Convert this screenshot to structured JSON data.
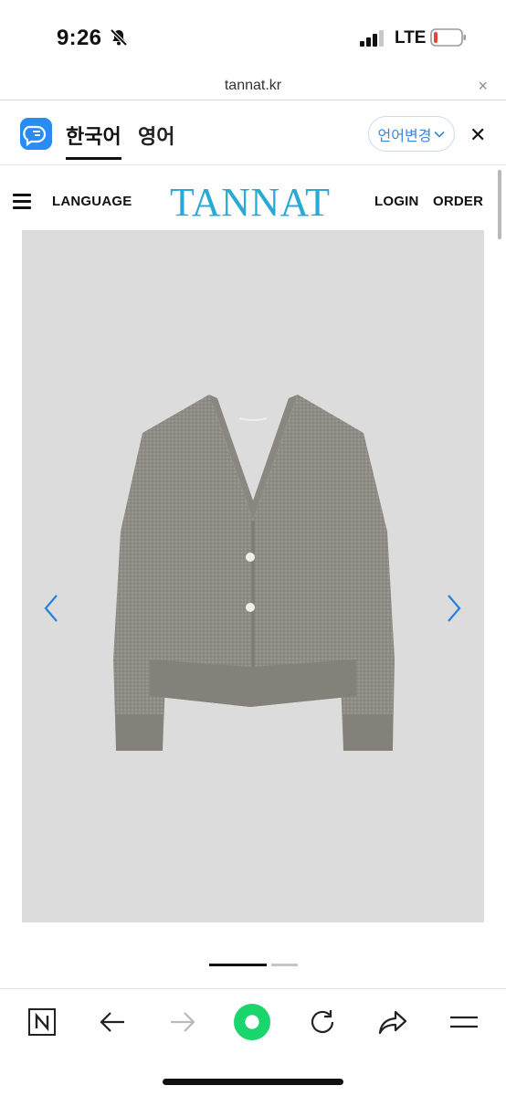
{
  "status_bar": {
    "time": "9:26",
    "network": "LTE",
    "battery_color": "#e0463e"
  },
  "url_bar": {
    "url": "tannat.kr",
    "close_label": "×"
  },
  "translate_bar": {
    "tabs": [
      "한국어",
      "영어"
    ],
    "active_tab": "한국어",
    "change_language_label": "언어변경",
    "close_label": "✕",
    "accent_color": "#3a86d8"
  },
  "site_header": {
    "language_label": "LANGUAGE",
    "logo": "TANNAT",
    "login_label": "LOGIN",
    "order_label": "ORDER",
    "logo_color": "#29a9d4"
  },
  "carousel": {
    "image_description_icon": "grey-knit-cardigan-image",
    "prev_icon": "chevron-left-icon",
    "next_icon": "chevron-right-icon",
    "page_count": 2,
    "current_page": 1,
    "arrow_color": "#2a7fdb"
  },
  "toolbar": {
    "buttons": [
      "naver-icon",
      "back-arrow-icon",
      "forward-arrow-icon",
      "green-home-icon",
      "reload-icon",
      "share-icon",
      "menu-icon"
    ],
    "home_color": "#19d56b"
  }
}
